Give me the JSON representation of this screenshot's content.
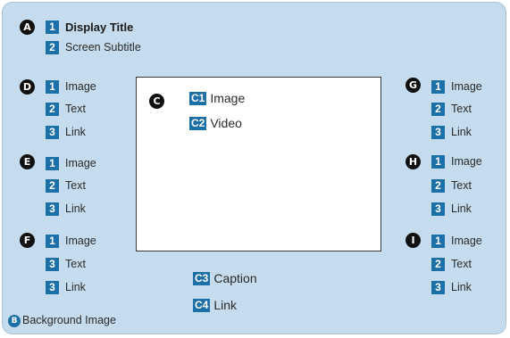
{
  "colors": {
    "panel_background": "#c4dced",
    "badge_blue": "#1d6fa8",
    "marker_black": "#101010",
    "content_area": "#ffffff"
  },
  "region_a": {
    "marker": "A",
    "title": {
      "num": "1",
      "label": "Display Title"
    },
    "subtitle": {
      "num": "2",
      "label": "Screen Subtitle"
    }
  },
  "region_b": {
    "marker": "B",
    "label": "Background Image"
  },
  "region_c": {
    "marker": "C",
    "items": [
      {
        "num": "C1",
        "label": "Image"
      },
      {
        "num": "C2",
        "label": "Video"
      },
      {
        "num": "C3",
        "label": "Caption"
      },
      {
        "num": "C4",
        "label": "Link"
      }
    ]
  },
  "region_d": {
    "marker": "D",
    "items": [
      {
        "num": "1",
        "label": "Image"
      },
      {
        "num": "2",
        "label": "Text"
      },
      {
        "num": "3",
        "label": "Link"
      }
    ]
  },
  "region_e": {
    "marker": "E",
    "items": [
      {
        "num": "1",
        "label": "Image"
      },
      {
        "num": "2",
        "label": "Text"
      },
      {
        "num": "3",
        "label": "Link"
      }
    ]
  },
  "region_f": {
    "marker": "F",
    "items": [
      {
        "num": "1",
        "label": "Image"
      },
      {
        "num": "3",
        "label": "Text"
      },
      {
        "num": "3",
        "label": "Link"
      }
    ]
  },
  "region_g": {
    "marker": "G",
    "items": [
      {
        "num": "1",
        "label": "Image"
      },
      {
        "num": "2",
        "label": "Text"
      },
      {
        "num": "3",
        "label": "Link"
      }
    ]
  },
  "region_h": {
    "marker": "H",
    "items": [
      {
        "num": "1",
        "label": "Image"
      },
      {
        "num": "2",
        "label": "Text"
      },
      {
        "num": "3",
        "label": "Link"
      }
    ]
  },
  "region_i": {
    "marker": "I",
    "items": [
      {
        "num": "1",
        "label": "Image"
      },
      {
        "num": "2",
        "label": "Text"
      },
      {
        "num": "3",
        "label": "Link"
      }
    ]
  }
}
